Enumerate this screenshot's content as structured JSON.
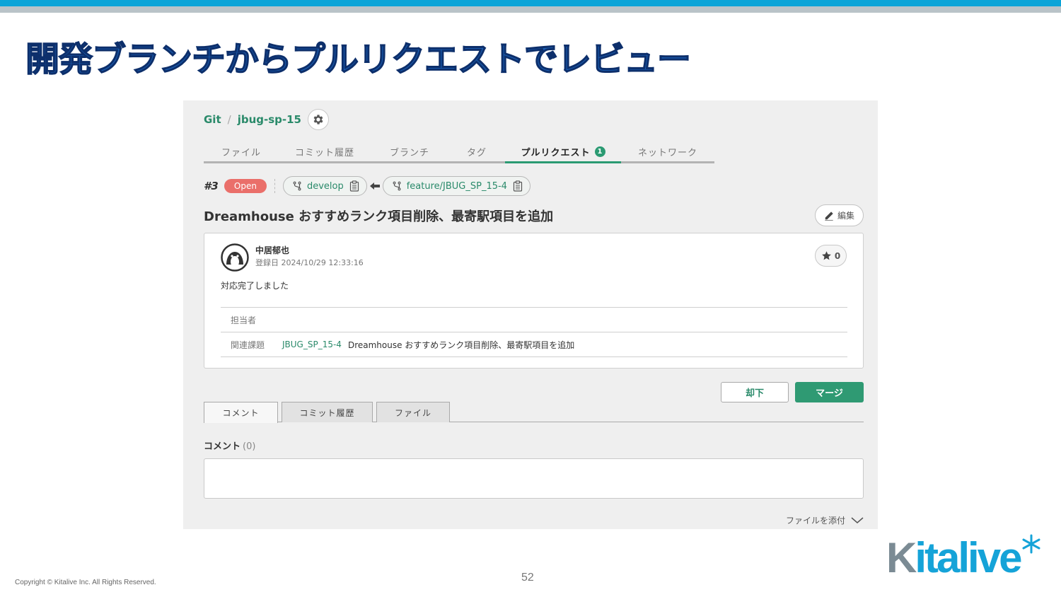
{
  "slide": {
    "title": "開発ブランチからプルリクエストでレビュー",
    "copyright": "Copyright © Kitalive Inc. All Rights Reserved.",
    "page_number": "52",
    "logo": "Kitalive"
  },
  "breadcrumb": {
    "root": "Git",
    "separator": "/",
    "repo": "jbug-sp-15"
  },
  "nav": {
    "tabs": [
      {
        "label": "ファイル"
      },
      {
        "label": "コミット履歴"
      },
      {
        "label": "ブランチ"
      },
      {
        "label": "タグ"
      },
      {
        "label": "プルリクエスト",
        "badge": "1"
      },
      {
        "label": "ネットワーク"
      }
    ],
    "active_tab": "プルリクエスト"
  },
  "pull_request": {
    "number": "#3",
    "status": "Open",
    "target_branch": "develop",
    "source_branch": "feature/JBUG_SP_15-4",
    "title": "Dreamhouse おすすめランク項目削除、最寄駅項目を追加",
    "edit_label": "編集",
    "author": "中居郁也",
    "registered_date": "登録日  2024/10/29 12:33:16",
    "star_count": "0",
    "description": "対応完了しました",
    "assignee_label": "担当者",
    "assignee_value": "",
    "related_issue_label": "関連課題",
    "related_issue_key": "JBUG_SP_15-4",
    "related_issue_summary": "Dreamhouse おすすめランク項目削除、最寄駅項目を追加"
  },
  "actions": {
    "reject_label": "却下",
    "merge_label": "マージ"
  },
  "subtabs": [
    {
      "label": "コメント"
    },
    {
      "label": "コミット履歴"
    },
    {
      "label": "ファイル"
    }
  ],
  "comments": {
    "label": "コメント",
    "count": "(0)",
    "input_value": "",
    "attach_label": "ファイルを添付"
  },
  "colors": {
    "accent_green": "#2f9a73",
    "status_open": "#ea6f6a",
    "title_blue": "#1a5fb4",
    "brand_blue": "#15a3d8"
  }
}
